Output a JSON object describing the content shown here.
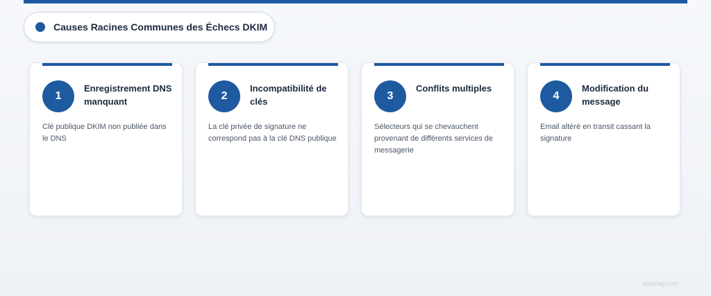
{
  "header": {
    "title": "Causes Racines Communes des Échecs DKIM"
  },
  "cards": [
    {
      "number": "1",
      "title": "Enregistrement DNS manquant",
      "description": "Clé publique DKIM non publiée dans le DNS"
    },
    {
      "number": "2",
      "title": "Incompatibilité de clés",
      "description": "La clé privée de signature ne correspond pas à la clé DNS publique"
    },
    {
      "number": "3",
      "title": "Conflits multiples",
      "description": "Sélecteurs qui se chevauchent provenant de différents services de messagerie"
    },
    {
      "number": "4",
      "title": "Modification du message",
      "description": "Email altéré en transit cassant la signature"
    }
  ],
  "footer": {
    "watermark": "skysnag.com"
  },
  "colors": {
    "accent": "#1e5aa0",
    "text_dark": "#1b2a3d",
    "text_muted": "#4b5667"
  }
}
